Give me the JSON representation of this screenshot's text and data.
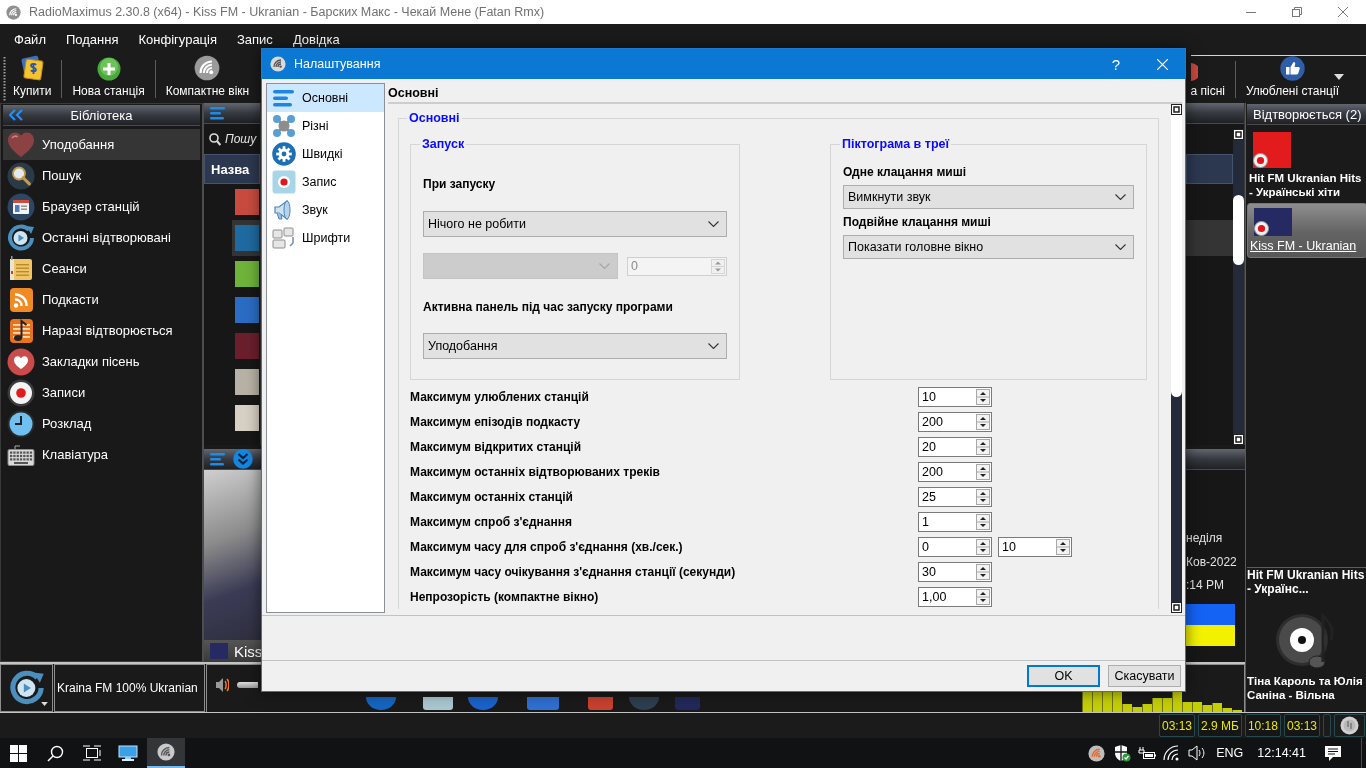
{
  "main_window": {
    "title": "RadioMaximus 2.30.8 (x64) - Kiss FM - Ukranian - Барских Макс - Чекай Мене (Fatan Rmx)"
  },
  "menu": [
    "Файл",
    "Подання",
    "Конфігурація",
    "Запис",
    "Довідка"
  ],
  "toolbar": {
    "left": [
      {
        "kind": "buy",
        "label": "Купити",
        "dropdown": false
      },
      {
        "kind": "add",
        "label": "Нова станція",
        "dropdown": false
      },
      {
        "kind": "compact",
        "label": "Компактне вікн",
        "dropdown": false
      }
    ],
    "right": [
      {
        "kind": "bookmark",
        "label": "а пісні",
        "dropdown": false
      },
      {
        "kind": "favorites",
        "label": "Улюблені станції",
        "dropdown": true
      }
    ]
  },
  "library": {
    "title": "Бібліотека",
    "items": [
      {
        "kind": "favorites",
        "label": "Уподобання",
        "selected": true
      },
      {
        "kind": "search",
        "label": "Пошук",
        "selected": false
      },
      {
        "kind": "browser",
        "label": "Браузер станцій",
        "selected": false
      },
      {
        "kind": "recent",
        "label": "Останні відтворювані",
        "selected": false
      },
      {
        "kind": "sessions",
        "label": "Сеанси",
        "selected": false
      },
      {
        "kind": "podcasts",
        "label": "Подкасти",
        "selected": false
      },
      {
        "kind": "nowplaying",
        "label": "Наразі відтворюється",
        "selected": false
      },
      {
        "kind": "bookmarks",
        "label": "Закладки пісень",
        "selected": false
      },
      {
        "kind": "recordings",
        "label": "Записи",
        "selected": false
      },
      {
        "kind": "schedule",
        "label": "Розклад",
        "selected": false
      },
      {
        "kind": "keyboard",
        "label": "Клавіатура",
        "selected": false
      }
    ]
  },
  "station_list": {
    "search": {
      "placeholder": "Пошу"
    },
    "column": "Назва",
    "rows": [
      {
        "selected": false
      },
      {
        "selected": true
      },
      {
        "selected": false
      },
      {
        "selected": false
      },
      {
        "selected": false
      },
      {
        "selected": false
      },
      {
        "selected": false
      }
    ]
  },
  "player": {
    "station": "Kiss",
    "day": "неділя",
    "date": "Ков-2022",
    "time": ":14 PM"
  },
  "now_playing": {
    "title": "Відтворюється (2)",
    "items": [
      {
        "name": "Hit FM Ukranian Hits - Українські хіти",
        "selected": false
      },
      {
        "name": "Kiss FM - Ukranian",
        "selected": true
      }
    ],
    "station": "Hit FM Ukranian Hits - Українс...",
    "track": "Тіна Кароль та Юлія Саніна - Вільна"
  },
  "bottom_bar": {
    "station": "Kraina FM 100% Ukranian"
  },
  "status_bar": [
    "03:13",
    "2.9 МБ",
    "10:18",
    "03:13"
  ],
  "taskbar": {
    "apps": [
      {
        "kind": "desktop",
        "active": false
      },
      {
        "kind": "radio",
        "active": true
      }
    ],
    "language": "ENG",
    "time": "12:14:41"
  },
  "dialog": {
    "title": "Налаштування",
    "help": "?",
    "nav": [
      {
        "kind": "general",
        "label": "Основні",
        "selected": true
      },
      {
        "kind": "misc",
        "label": "Різні",
        "selected": false
      },
      {
        "kind": "quick",
        "label": "Швидкі",
        "selected": false
      },
      {
        "kind": "record",
        "label": "Запис",
        "selected": false
      },
      {
        "kind": "sound",
        "label": "Звук",
        "selected": false
      },
      {
        "kind": "fonts",
        "label": "Шрифти",
        "selected": false
      }
    ],
    "page_title": "Основні",
    "group_title": "Основні",
    "startup": {
      "legend": "Запуск",
      "on_start": {
        "label": "При запуску",
        "value": "Нічого не робити"
      },
      "extra": {
        "disabled": true,
        "number": "0"
      },
      "active_panel": {
        "label": "Активна панель під час запуску програми",
        "value": "Уподобання"
      }
    },
    "tray": {
      "legend": "Піктограма в треї",
      "single_click": {
        "label": "Одне клацання миші",
        "value": "Вимкнути звук"
      },
      "double_click": {
        "label": "Подвійне клацання миші",
        "value": "Показати головне вікно"
      }
    },
    "limits": [
      {
        "label": "Максимум улюблених станцій",
        "values": [
          "10"
        ]
      },
      {
        "label": "Максимум епізодів подкасту",
        "values": [
          "200"
        ]
      },
      {
        "label": "Максимум відкритих станцій",
        "values": [
          "20"
        ]
      },
      {
        "label": "Максимум останніх відтворюваних треків",
        "values": [
          "200"
        ]
      },
      {
        "label": "Максимум останніх станцій",
        "values": [
          "25"
        ]
      },
      {
        "label": "Максимум спроб з'єднання",
        "values": [
          "1"
        ]
      },
      {
        "label": "Максимум часу для спроб з'єднання (хв./сек.)",
        "values": [
          "0",
          "10"
        ]
      },
      {
        "label": "Максимум часу очікування з'єднання станції (секунди)",
        "values": [
          "30"
        ]
      },
      {
        "label": "Непрозорість (компактне вікно)",
        "values": [
          "1,00"
        ]
      }
    ],
    "buttons": [
      {
        "label": "OK",
        "default": true
      },
      {
        "label": "Скасувати",
        "default": false
      }
    ]
  }
}
